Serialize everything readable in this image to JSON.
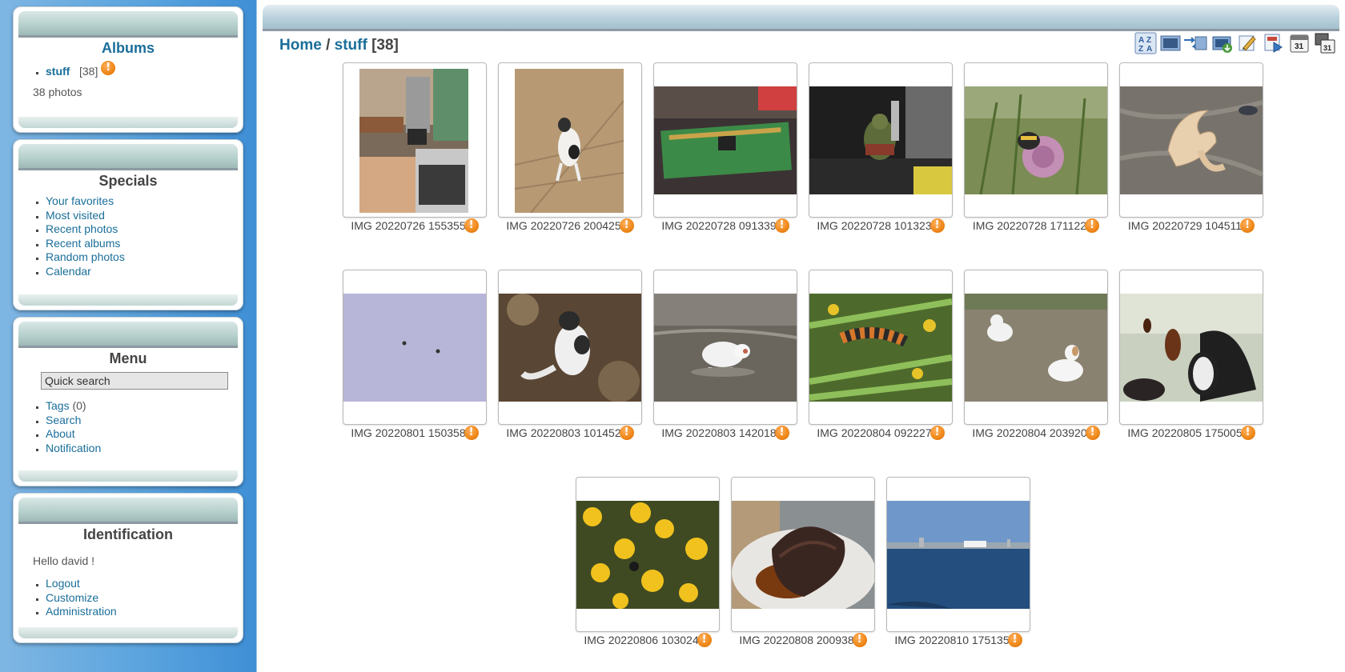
{
  "sidebar": {
    "albums": {
      "title": "Albums",
      "items": [
        {
          "label": "stuff",
          "count": "[38]"
        }
      ],
      "summary": "38 photos"
    },
    "specials": {
      "title": "Specials",
      "items": [
        "Your favorites",
        "Most visited",
        "Recent photos",
        "Recent albums",
        "Random photos",
        "Calendar"
      ]
    },
    "menu": {
      "title": "Menu",
      "search_value": "Quick search",
      "items": [
        {
          "label": "Tags",
          "suffix": "(0)"
        },
        {
          "label": "Search",
          "suffix": ""
        },
        {
          "label": "About",
          "suffix": ""
        },
        {
          "label": "Notification",
          "suffix": ""
        }
      ]
    },
    "identification": {
      "title": "Identification",
      "greeting": "Hello david !",
      "items": [
        "Logout",
        "Customize",
        "Administration"
      ]
    }
  },
  "main": {
    "breadcrumb": {
      "home": "Home",
      "separator": "/",
      "album": "stuff",
      "count": "[38]"
    },
    "toolbar": [
      "sort-az-icon",
      "display-mode-icon",
      "download-icon",
      "edit-icon",
      "slideshow-icon",
      "calendar-icon",
      "calendar-post-icon"
    ],
    "photos": [
      {
        "caption": "IMG 20220726 155355",
        "subject": "kitchen",
        "orientation": "portrait"
      },
      {
        "caption": "IMG 20220726 200425",
        "subject": "dog on sand",
        "orientation": "portrait"
      },
      {
        "caption": "IMG 20220728 091339",
        "subject": "circuit board",
        "orientation": "landscape"
      },
      {
        "caption": "IMG 20220728 101323",
        "subject": "figurine",
        "orientation": "landscape"
      },
      {
        "caption": "IMG 20220728 171122",
        "subject": "bee on thistle",
        "orientation": "landscape"
      },
      {
        "caption": "IMG 20220729 104511",
        "subject": "crab claw",
        "orientation": "landscape"
      },
      {
        "caption": "IMG 20220801 150358",
        "subject": "sky",
        "orientation": "landscape"
      },
      {
        "caption": "IMG 20220803 101452",
        "subject": "dog in shade",
        "orientation": "landscape"
      },
      {
        "caption": "IMG 20220803 142018",
        "subject": "dog in water",
        "orientation": "landscape"
      },
      {
        "caption": "IMG 20220804 092227",
        "subject": "caterpillar",
        "orientation": "landscape"
      },
      {
        "caption": "IMG 20220804 203920",
        "subject": "two dogs on grass",
        "orientation": "landscape"
      },
      {
        "caption": "IMG 20220805 175005",
        "subject": "beetles",
        "orientation": "landscape"
      },
      {
        "caption": "IMG 20220806 103024",
        "subject": "yellow flowers",
        "orientation": "landscape"
      },
      {
        "caption": "IMG 20220808 200938",
        "subject": "meat on plate",
        "orientation": "landscape"
      },
      {
        "caption": "IMG 20220810 175135",
        "subject": "harbour skyline",
        "orientation": "landscape"
      }
    ]
  },
  "colors": {
    "link": "#1a6e9a",
    "warning": "#f08a1c",
    "sidebar_bg": "#3f8fd6"
  }
}
